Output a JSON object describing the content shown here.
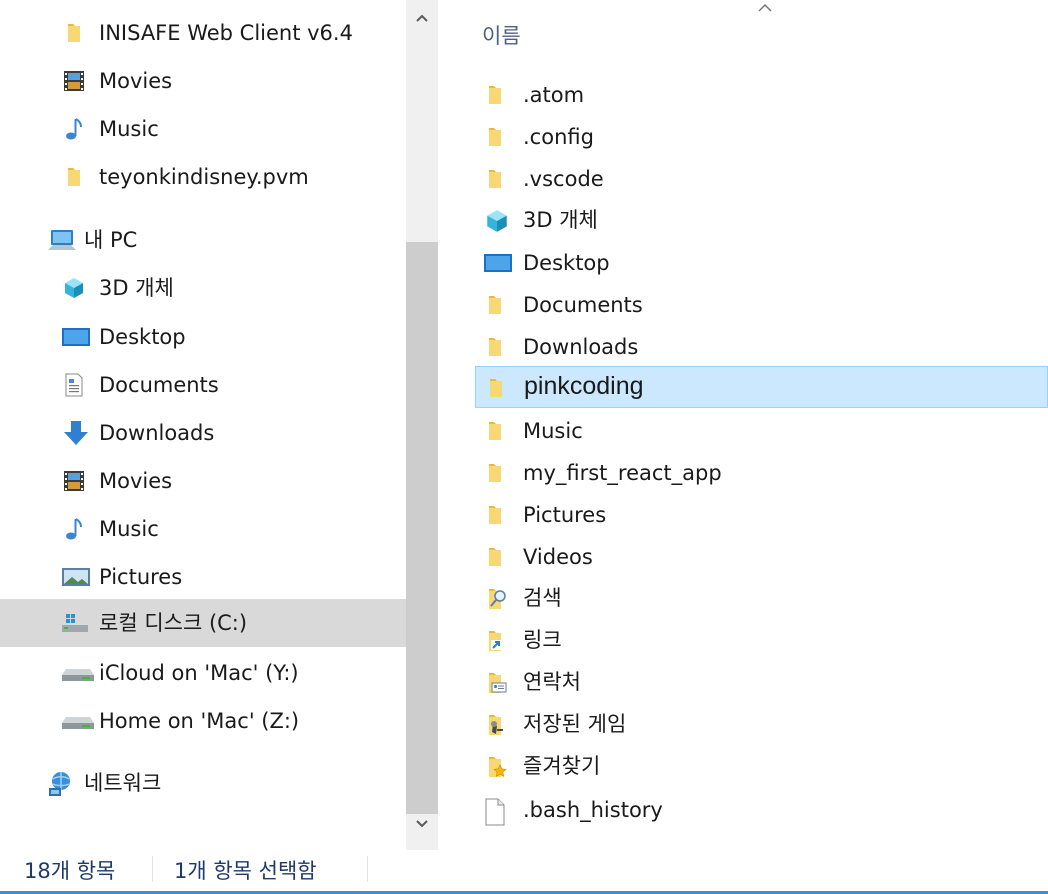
{
  "nav": {
    "items": [
      {
        "label": "INISAFE Web Client v6.4",
        "icon": "folder-icon"
      },
      {
        "label": "Movies",
        "icon": "movies-icon"
      },
      {
        "label": "Music",
        "icon": "music-icon"
      },
      {
        "label": "teyonkindisney.pvm",
        "icon": "folder-icon"
      },
      {
        "label": "내 PC",
        "icon": "computer-icon"
      },
      {
        "label": "3D 개체",
        "icon": "3d-objects-icon"
      },
      {
        "label": "Desktop",
        "icon": "desktop-icon"
      },
      {
        "label": "Documents",
        "icon": "documents-icon"
      },
      {
        "label": "Downloads",
        "icon": "downloads-icon"
      },
      {
        "label": "Movies",
        "icon": "movies-icon"
      },
      {
        "label": "Music",
        "icon": "music-icon"
      },
      {
        "label": "Pictures",
        "icon": "pictures-icon"
      },
      {
        "label": "로컬 디스크 (C:)",
        "icon": "windows-drive-icon",
        "selected": true
      },
      {
        "label": "iCloud on 'Mac' (Y:)",
        "icon": "network-drive-icon"
      },
      {
        "label": "Home on 'Mac' (Z:)",
        "icon": "network-drive-icon"
      },
      {
        "label": "네트워크",
        "icon": "network-icon"
      }
    ]
  },
  "list": {
    "column_header": "이름",
    "items": [
      {
        "label": ".atom",
        "icon": "folder-icon"
      },
      {
        "label": ".config",
        "icon": "folder-icon"
      },
      {
        "label": ".vscode",
        "icon": "folder-icon"
      },
      {
        "label": "3D 개체",
        "icon": "3d-objects-icon"
      },
      {
        "label": "Desktop",
        "icon": "desktop-icon"
      },
      {
        "label": "Documents",
        "icon": "folder-icon"
      },
      {
        "label": "Downloads",
        "icon": "folder-icon"
      },
      {
        "label": "pinkcoding",
        "icon": "folder-icon",
        "selected": true
      },
      {
        "label": "Music",
        "icon": "folder-icon"
      },
      {
        "label": "my_first_react_app",
        "icon": "folder-icon"
      },
      {
        "label": "Pictures",
        "icon": "folder-icon"
      },
      {
        "label": "Videos",
        "icon": "folder-icon"
      },
      {
        "label": "검색",
        "icon": "search-folder-icon"
      },
      {
        "label": "링크",
        "icon": "links-folder-icon"
      },
      {
        "label": "연락처",
        "icon": "contacts-folder-icon"
      },
      {
        "label": "저장된 게임",
        "icon": "saved-games-icon"
      },
      {
        "label": "즐겨찾기",
        "icon": "favorites-icon"
      },
      {
        "label": ".bash_history",
        "icon": "file-icon"
      }
    ]
  },
  "status": {
    "item_count": "18개 항목",
    "selected_count": "1개 항목 선택함"
  },
  "colors": {
    "selection_bg": "#cce8ff",
    "selection_border": "#99d1ff",
    "nav_selected_bg": "#d9d9d9",
    "status_text": "#1e3a6b",
    "folder_yellow": "#f8d775"
  }
}
